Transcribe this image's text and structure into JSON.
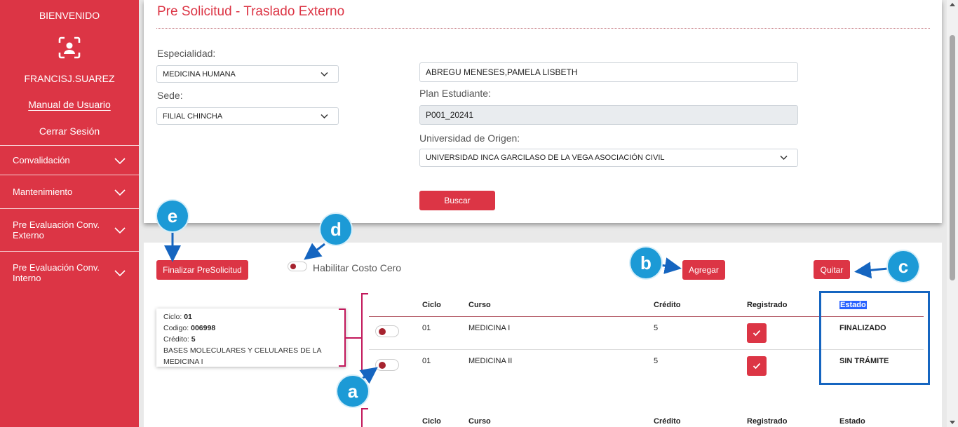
{
  "sidebar": {
    "welcome": "BIENVENIDO",
    "username": "FRANCISJ.SUAREZ",
    "manual": "Manual de Usuario",
    "logout": "Cerrar Sesión",
    "menu": [
      {
        "label": "Convalidación"
      },
      {
        "label": "Mantenimiento"
      },
      {
        "label": "Pre Evaluación Conv. Externo"
      },
      {
        "label": "Pre Evaluación Conv. Interno"
      }
    ],
    "avatar_icon": "user-scan-icon",
    "bg_color": "#dc3545"
  },
  "form": {
    "title": "Pre Solicitud - Traslado Externo",
    "especialidad_label": "Especialidad:",
    "especialidad_value": "MEDICINA HUMANA",
    "sede_label": "Sede:",
    "sede_value": "FILIAL CHINCHA",
    "student_name": "ABREGU MENESES,PAMELA LISBETH",
    "plan_label": "Plan Estudiante:",
    "plan_value": "P001_20241",
    "universidad_label": "Universidad de Origen:",
    "universidad_value": "UNIVERSIDAD INCA GARCILASO DE LA VEGA ASOCIACIÓN CIVIL",
    "buscar_label": "Buscar"
  },
  "actions": {
    "finalizar_label": "Finalizar PreSolicitud",
    "costo_cero_label": "Habilitar Costo Cero",
    "agregar_label": "Agregar",
    "quitar_label": "Quitar"
  },
  "tooltip": {
    "ciclo_label": "Ciclo:",
    "ciclo_value": "01",
    "codigo_label": "Codigo:",
    "codigo_value": "006998",
    "credito_label": "Crédito:",
    "credito_value": "5",
    "description": "BASES MOLECULARES Y CELULARES DE LA MEDICINA I"
  },
  "table": {
    "headers": {
      "ciclo": "Ciclo",
      "curso": "Curso",
      "credito": "Crédito",
      "registrado": "Registrado",
      "estado": "Estado"
    },
    "rows": [
      {
        "ciclo": "01",
        "curso": "MEDICINA I",
        "credito": "5",
        "estado": "FINALIZADO"
      },
      {
        "ciclo": "01",
        "curso": "MEDICINA II",
        "credito": "5",
        "estado": "SIN TRÁMITE"
      }
    ]
  },
  "table2": {
    "headers": {
      "ciclo": "Ciclo",
      "curso": "Curso",
      "credito": "Crédito",
      "registrado": "Registrado",
      "estado": "Estado"
    }
  },
  "annotations": {
    "a": "a",
    "b": "b",
    "c": "c",
    "d": "d",
    "e": "e",
    "color": "#1c9ad6"
  }
}
